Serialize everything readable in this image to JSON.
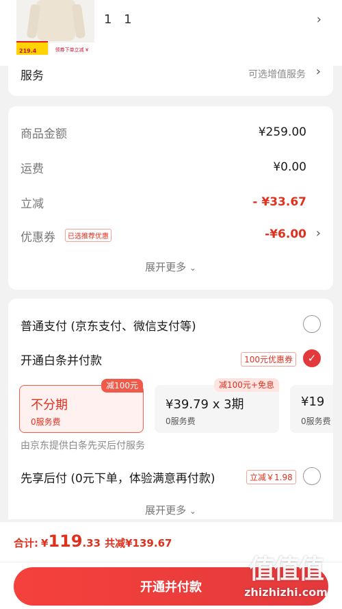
{
  "product": {
    "thumb_price": "219.4",
    "thumb_promo": "领券下单立减 ¥",
    "quantity": "1 1"
  },
  "service": {
    "label": "服务",
    "hint": "可选增值服务"
  },
  "price_summary": {
    "rows": [
      {
        "label": "商品金额",
        "value": "¥259.00"
      },
      {
        "label": "运费",
        "value": "¥0.00"
      },
      {
        "label": "立减",
        "value": "- ¥33.67"
      },
      {
        "label": "优惠券",
        "value": "-¥6.00",
        "tag": "已选推荐优惠"
      }
    ],
    "expand_label": "展开更多"
  },
  "payment": {
    "normal": {
      "label": "普通支付 (京东支付、微信支付等)"
    },
    "baitiao": {
      "label": "开通白条并付款",
      "promo_tag": "100元优惠券",
      "plans": [
        {
          "main": "不分期",
          "fee": "0服务费",
          "badge": "减100元"
        },
        {
          "main": "¥39.79 x 3期",
          "fee": "0服务费",
          "badge": "减100元+免息"
        },
        {
          "main": "¥19",
          "fee": "0服务费",
          "badge": ""
        }
      ],
      "note": "由京东提供白条先买后付服务"
    },
    "pay_later": {
      "label": "先享后付 (0元下单，体验满意再付款)",
      "promo_tag": "立减￥1.98"
    },
    "expand_label": "展开更多"
  },
  "bottom": {
    "total_label": "合计:",
    "currency": "¥",
    "total_int": "119",
    "total_dec": ".33",
    "savings": "共减¥139.67",
    "submit_label": "开通并付款"
  },
  "watermark": {
    "logo": "值值值",
    "site": "zhizhizhi.com"
  },
  "colors": {
    "accent": "#e4393c",
    "price_red": "#e0301e",
    "background": "#f2f2f2"
  }
}
